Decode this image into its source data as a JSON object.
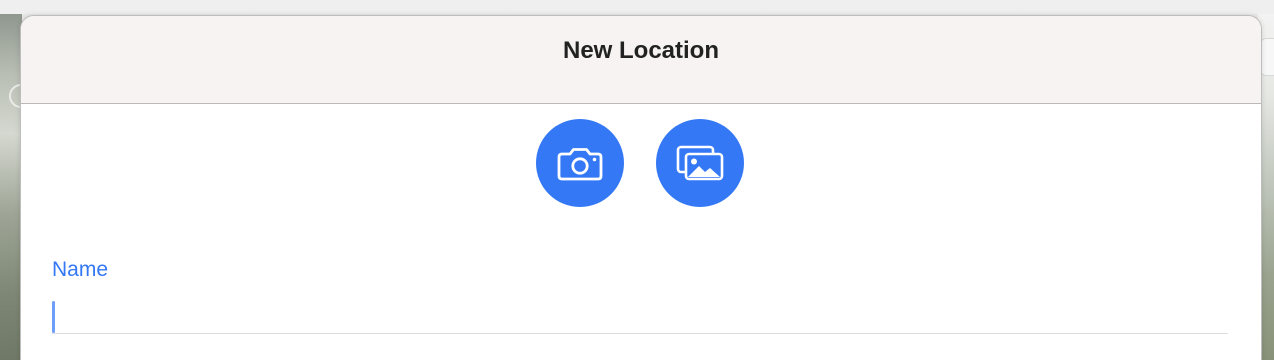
{
  "dialog": {
    "title": "New Location"
  },
  "photo_buttons": [
    {
      "icon": "camera-icon",
      "action": "take-photo"
    },
    {
      "icon": "photo-library-icon",
      "action": "choose-photo"
    }
  ],
  "form": {
    "name_label": "Name",
    "name_value": "",
    "name_placeholder": ""
  },
  "colors": {
    "accent": "#3478f6",
    "header_background": "#f6f3f2",
    "title_text": "#222222"
  }
}
